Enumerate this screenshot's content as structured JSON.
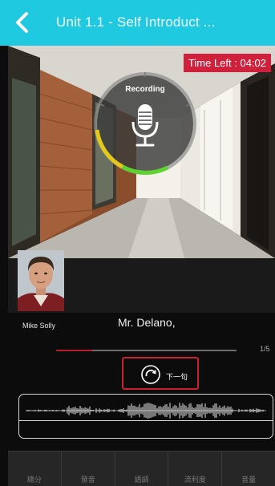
{
  "header": {
    "title": "Unit 1.1 - Self Introduct ...",
    "back_icon": "chevron-left-icon",
    "background_color": "#1fc9e0"
  },
  "timer": {
    "text": "Time Left : 04:02",
    "color": "#d0213c"
  },
  "recording": {
    "label": "Recording",
    "icon": "microphone-icon",
    "level_fraction": 0.4
  },
  "speaker": {
    "name": "Mike Solly",
    "sentence": "Mr. Delano,"
  },
  "progress": {
    "count_label": "1/5",
    "fraction": 0.2,
    "accent": "#b51f2c"
  },
  "next": {
    "label": "下一句",
    "icon": "redo-icon",
    "border_color": "#c8232c"
  },
  "tabs": [
    {
      "label": "總分"
    },
    {
      "label": "發音"
    },
    {
      "label": "語調"
    },
    {
      "label": "流利度"
    },
    {
      "label": "音量"
    }
  ]
}
